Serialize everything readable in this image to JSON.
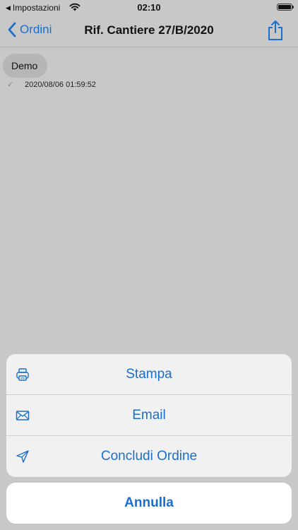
{
  "status_bar": {
    "back_app": "Impostazioni",
    "time": "02:10"
  },
  "nav": {
    "back_label": "Ordini",
    "title": "Rif. Cantiere 27/B/2020"
  },
  "message": {
    "text": "Demo",
    "timestamp": "2020/08/06 01:59:52"
  },
  "action_sheet": {
    "actions": [
      {
        "label": "Stampa",
        "icon": "printer-icon"
      },
      {
        "label": "Email",
        "icon": "envelope-icon"
      },
      {
        "label": "Concludi Ordine",
        "icon": "paper-plane-icon"
      }
    ],
    "cancel_label": "Annulla"
  },
  "colors": {
    "accent": "#1a6fce",
    "dim_background": "#c8c8c8"
  }
}
